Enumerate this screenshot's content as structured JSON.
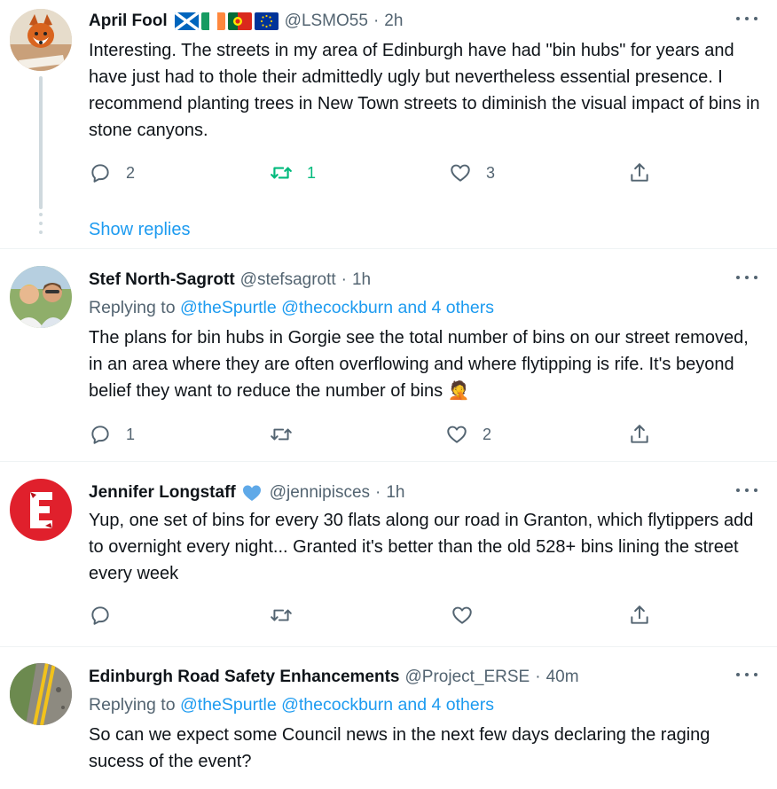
{
  "tweets": [
    {
      "name": "April Fool",
      "flags": [
        "flag-scotland-icon",
        "flag-ireland-icon",
        "flag-portugal-icon",
        "flag-eu-icon"
      ],
      "handle": "@LSMO55",
      "dot": "·",
      "time": "2h",
      "text": "Interesting. The streets in my area of Edinburgh have had \"bin hubs\" for years and have just had to thole their admittedly ugly but nevertheless essential presence. I recommend planting trees in New Town streets to diminish the visual impact of bins in stone canyons.",
      "replies": "2",
      "retweets": "1",
      "likes": "3",
      "show_replies": "Show replies"
    },
    {
      "name": "Stef North-Sagrott",
      "handle": "@stefsagrott",
      "dot": "·",
      "time": "1h",
      "replying_prefix": "Replying to ",
      "replying_to": "@theSpurtle @thecockburn and 4 others",
      "text": "The plans for bin hubs in Gorgie see the total number of bins on our street removed, in an area where they are often overflowing and where flytipping is rife. It's beyond belief they want to reduce the number of bins 🤦",
      "replies": "1",
      "retweets": "",
      "likes": "2"
    },
    {
      "name": "Jennifer Longstaff",
      "badge": "blue-heart-icon",
      "handle": "@jennipisces",
      "dot": "·",
      "time": "1h",
      "text": "Yup, one set of bins for every 30 flats along our road in Granton, which flytippers add to overnight every night...  Granted it's better than the old 528+ bins lining the street every week",
      "replies": "",
      "retweets": "",
      "likes": ""
    },
    {
      "name": "Edinburgh Road Safety Enhancements",
      "handle": "@Project_ERSE",
      "dot": "·",
      "time": "40m",
      "replying_prefix": "Replying to ",
      "replying_to": "@theSpurtle @thecockburn and 4 others",
      "text": "So can we expect some Council news in the next few days declaring the raging sucess of the event?"
    }
  ],
  "colors": {
    "accent": "#1d9bf0",
    "retweet_active": "#00ba7c",
    "muted": "#536471",
    "divider": "#eff3f4"
  }
}
